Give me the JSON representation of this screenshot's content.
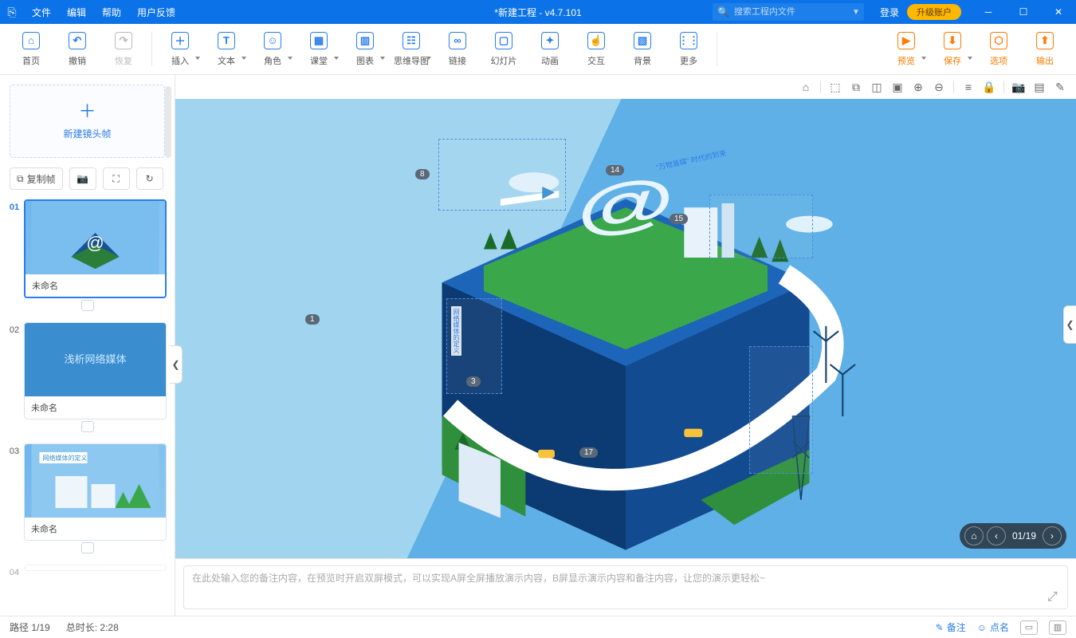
{
  "titlebar": {
    "menus": {
      "file": "文件",
      "edit": "编辑",
      "help": "帮助",
      "feedback": "用户反馈"
    },
    "title": "*新建工程 - v4.7.101",
    "search_placeholder": "搜索工程内文件",
    "login": "登录",
    "upgrade": "升级账户"
  },
  "toolbar": {
    "home": "首页",
    "undo": "撤销",
    "redo": "恢复",
    "insert": "插入",
    "text": "文本",
    "role": "角色",
    "class": "课堂",
    "chart": "图表",
    "mindmap": "思维导图",
    "link": "链接",
    "slide": "幻灯片",
    "anim": "动画",
    "interact": "交互",
    "bg": "背景",
    "more": "更多",
    "preview": "预览",
    "save": "保存",
    "options": "选项",
    "export": "输出"
  },
  "sidebar": {
    "new_frame": "新建镜头帧",
    "copy_frame": "复制帧",
    "thumbs": [
      {
        "num": "01",
        "caption": "未命名",
        "active": true,
        "text": ""
      },
      {
        "num": "02",
        "caption": "未命名",
        "active": false,
        "text": "浅析网络媒体"
      },
      {
        "num": "03",
        "caption": "未命名",
        "active": false,
        "text": "网络媒体的定义"
      },
      {
        "num": "04",
        "caption": "",
        "active": false,
        "text": ""
      }
    ]
  },
  "canvas": {
    "markers": [
      "1",
      "3",
      "8",
      "14",
      "15",
      "17"
    ],
    "selection_label_v": "网络媒体的定义",
    "annotation_top": "\"万物皆媒\" 时代的到来",
    "nav": {
      "current": "01",
      "total": "19"
    }
  },
  "notes": {
    "placeholder": "在此处输入您的备注内容，在预览时开启双屏模式，可以实现A屏全屏播放演示内容，B屏显示演示内容和备注内容，让您的演示更轻松~"
  },
  "status": {
    "path": "路径 1/19",
    "duration_label": "总时长:",
    "duration": "2:28",
    "note": "备注",
    "roll": "点名"
  }
}
